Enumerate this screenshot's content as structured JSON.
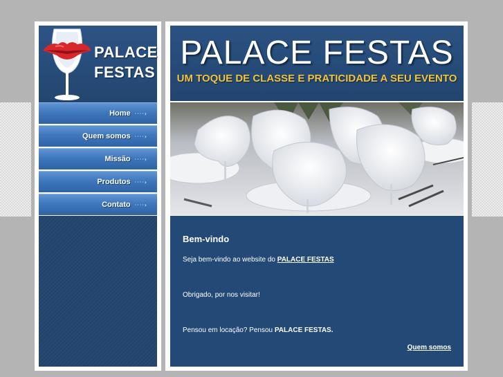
{
  "brand": {
    "logo_line1": "PALACE",
    "logo_line2": "FESTAS",
    "title": "PALACE FESTAS",
    "tagline": "UM TOQUE DE CLASSE E PRATICIDADE A SEU EVENTO"
  },
  "nav": {
    "items": [
      {
        "label": "Home"
      },
      {
        "label": "Quem somos"
      },
      {
        "label": "Missão"
      },
      {
        "label": "Produtos"
      },
      {
        "label": "Contato"
      }
    ],
    "arrow": "····›"
  },
  "content": {
    "heading": "Bem-vindo",
    "welcome_prefix": "Seja bem-vindo ao website do",
    "welcome_link": "PALACE FESTAS",
    "thanks": "Obrigado, por nos visitar!",
    "question_prefix": "Pensou em locação? Pensou",
    "question_brand": "PALACE FESTAS.",
    "more_link": "Quem somos"
  },
  "colors": {
    "background": "#b4b4b4",
    "panel_blue": "#234a77",
    "nav_blue": "#3f77bd",
    "tagline_gold": "#f3c33a",
    "lips_red": "#d8262b"
  },
  "icons": {
    "logo": "wine-glass-lips-icon",
    "nav_arrow": "chevron-right-icon"
  }
}
